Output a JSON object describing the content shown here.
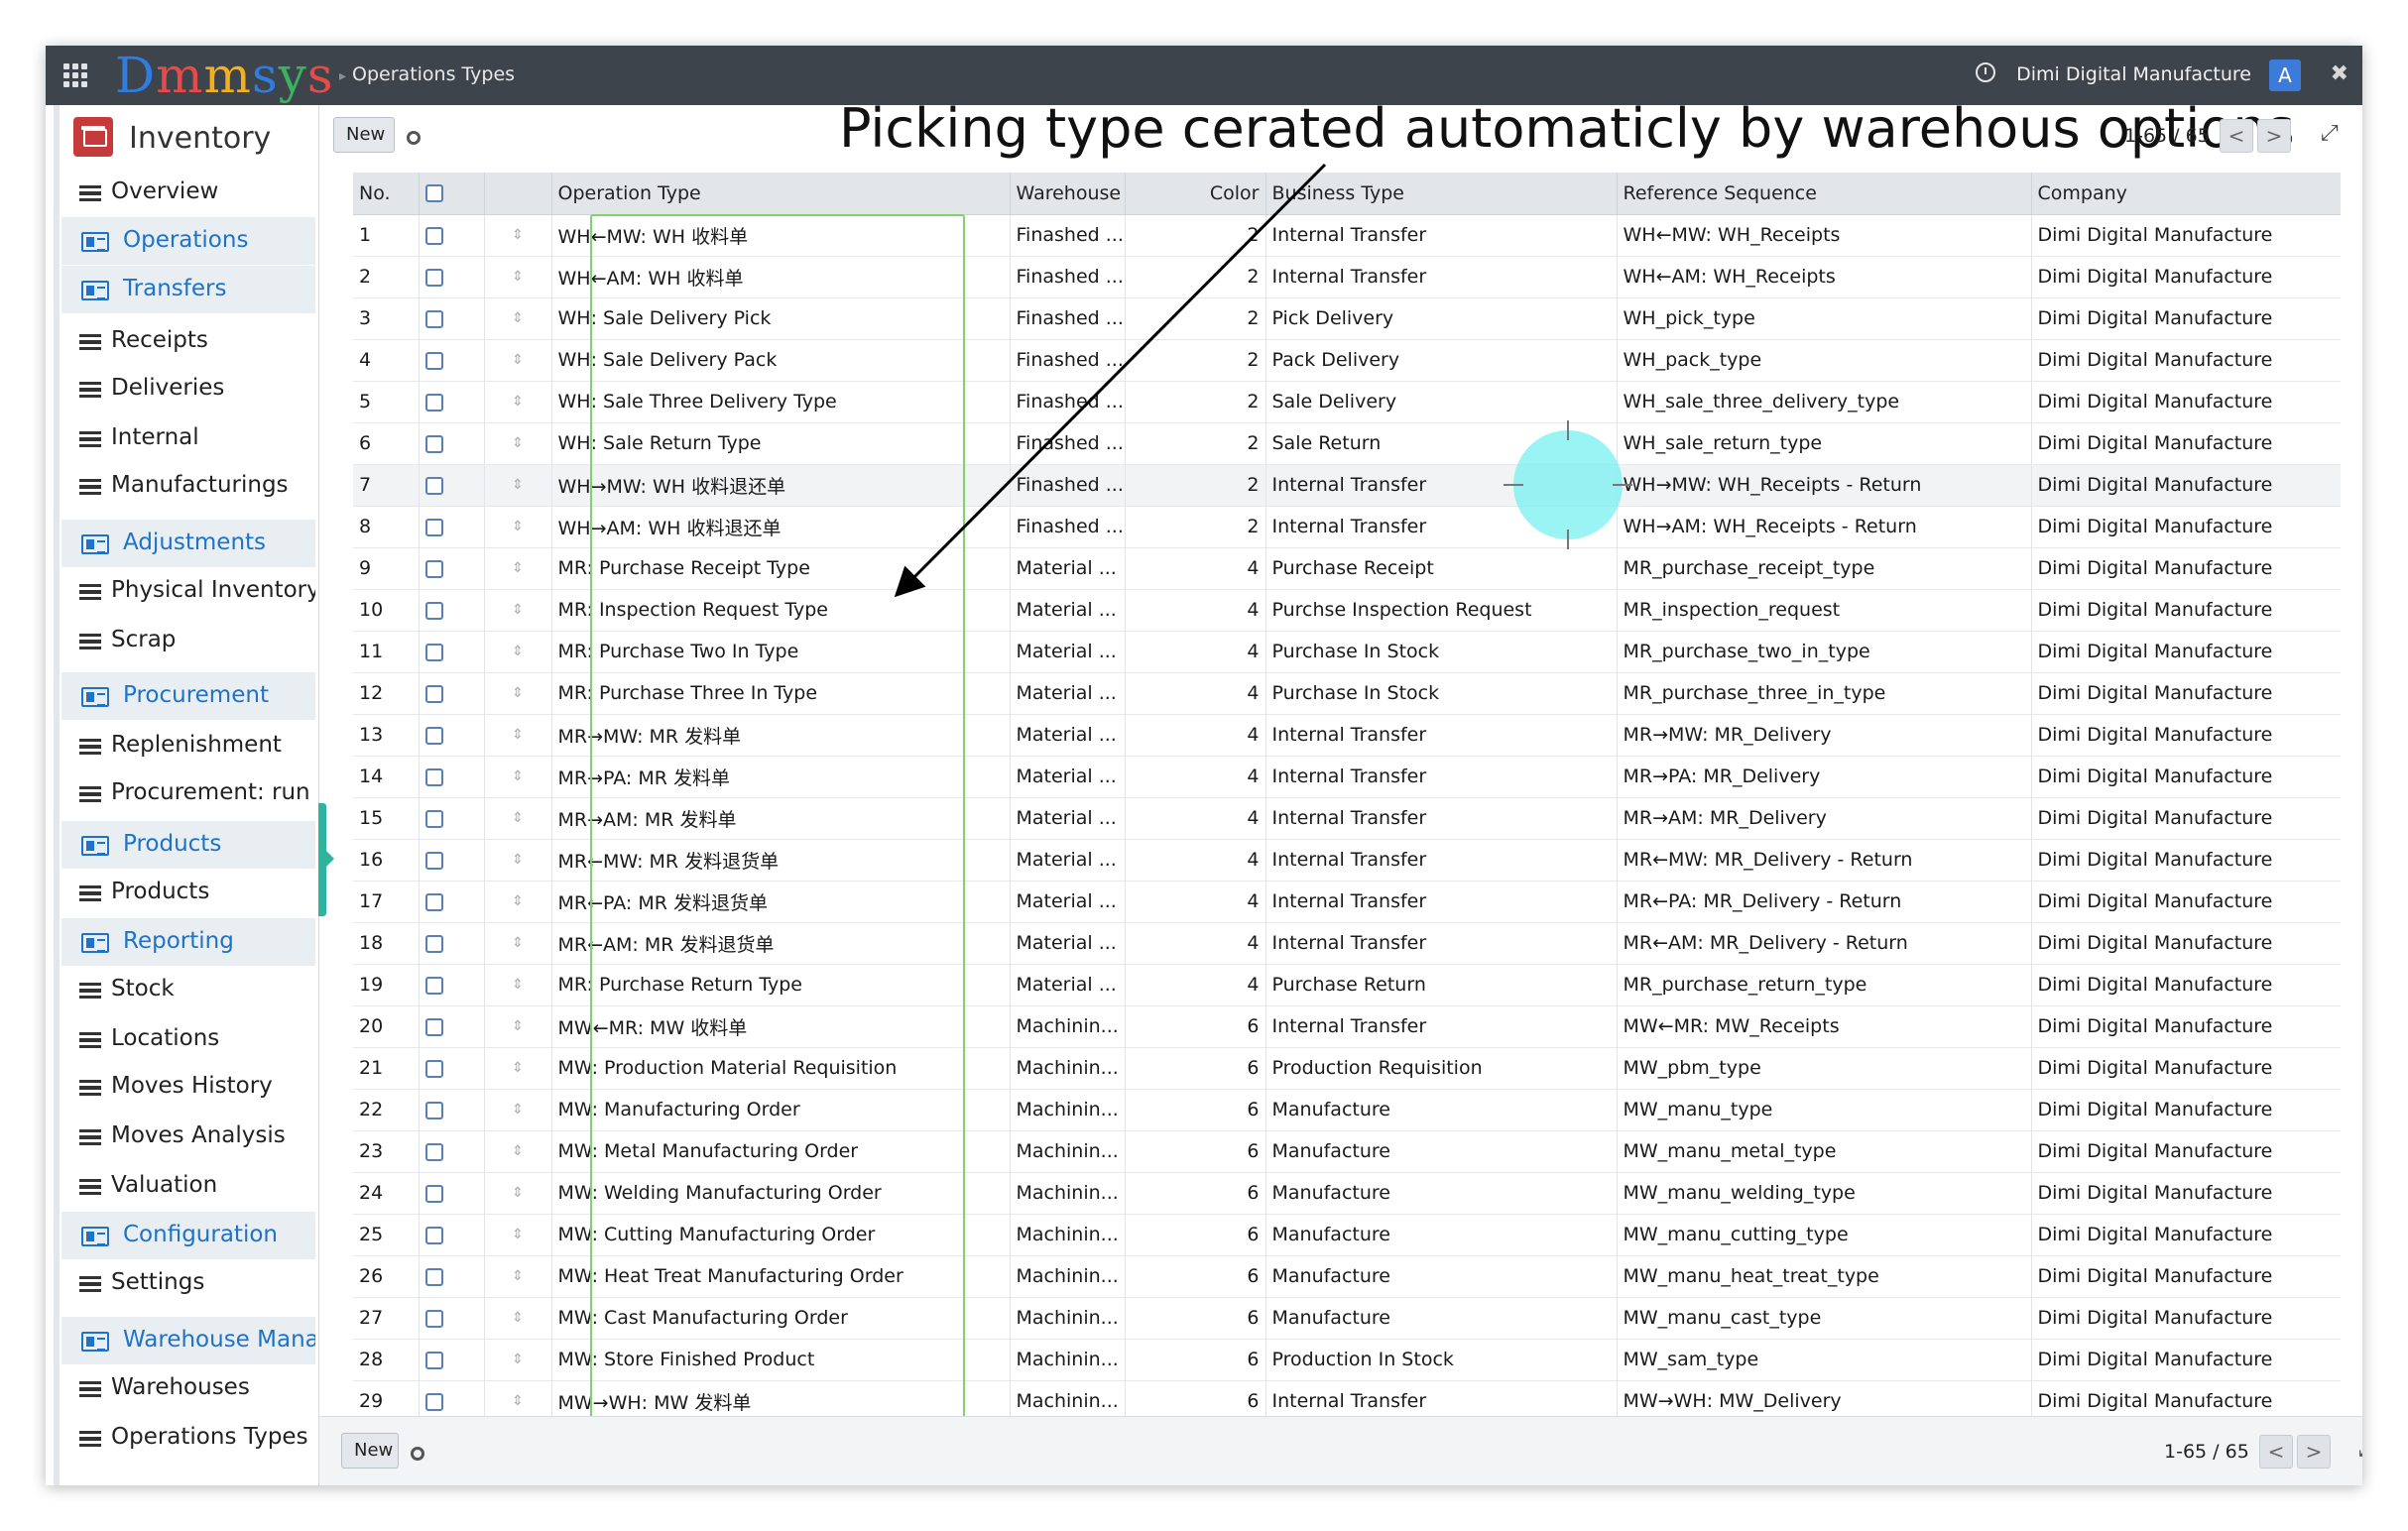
{
  "topbar": {
    "logo": [
      "D",
      "m",
      "m",
      "s",
      "y",
      "s"
    ],
    "breadcrumb": "Operations Types",
    "company": "Dimi Digital Manufacture",
    "avatar": "A"
  },
  "sidebar": {
    "app_name": "Inventory",
    "items": [
      {
        "label": "Overview",
        "group": false
      },
      {
        "label": "Operations",
        "group": true
      },
      {
        "label": "Transfers",
        "group": true
      },
      {
        "label": "Receipts",
        "group": false
      },
      {
        "label": "Deliveries",
        "group": false
      },
      {
        "label": "Internal",
        "group": false
      },
      {
        "label": "Manufacturings",
        "group": false
      },
      {
        "label": "Adjustments",
        "group": true
      },
      {
        "label": "Physical Inventory",
        "group": false
      },
      {
        "label": "Scrap",
        "group": false
      },
      {
        "label": "Procurement",
        "group": true
      },
      {
        "label": "Replenishment",
        "group": false
      },
      {
        "label": "Procurement: run",
        "group": false
      },
      {
        "label": "Products",
        "group": true
      },
      {
        "label": "Products",
        "group": false
      },
      {
        "label": "Reporting",
        "group": true
      },
      {
        "label": "Stock",
        "group": false
      },
      {
        "label": "Locations",
        "group": false
      },
      {
        "label": "Moves History",
        "group": false
      },
      {
        "label": "Moves Analysis",
        "group": false
      },
      {
        "label": "Valuation",
        "group": false
      },
      {
        "label": "Configuration",
        "group": true
      },
      {
        "label": "Settings",
        "group": false
      },
      {
        "label": "Warehouse Manag",
        "group": true
      },
      {
        "label": "Warehouses",
        "group": false
      },
      {
        "label": "Operations Types",
        "group": false
      }
    ]
  },
  "control": {
    "new_label": "New",
    "annotation": "Picking type cerated automaticly by warehous options",
    "pager": "1-65 / 65",
    "prev": "<",
    "next": ">"
  },
  "footer": {
    "new_label": "New",
    "pager": "1-65 / 65"
  },
  "table": {
    "columns": [
      "No.",
      "",
      "",
      "Operation Type",
      "Warehouse",
      "Color",
      "Business Type",
      "Reference Sequence",
      "Company"
    ],
    "rows": [
      [
        "1",
        "WH←MW: WH 收料单",
        "Finashed ...",
        "2",
        "Internal Transfer",
        "WH←MW: WH_Receipts",
        "Dimi Digital Manufacture"
      ],
      [
        "2",
        "WH←AM: WH 收料单",
        "Finashed ...",
        "2",
        "Internal Transfer",
        "WH←AM: WH_Receipts",
        "Dimi Digital Manufacture"
      ],
      [
        "3",
        "WH: Sale Delivery Pick",
        "Finashed ...",
        "2",
        "Pick Delivery",
        "WH_pick_type",
        "Dimi Digital Manufacture"
      ],
      [
        "4",
        "WH: Sale Delivery Pack",
        "Finashed ...",
        "2",
        "Pack Delivery",
        "WH_pack_type",
        "Dimi Digital Manufacture"
      ],
      [
        "5",
        "WH: Sale Three Delivery Type",
        "Finashed ...",
        "2",
        "Sale Delivery",
        "WH_sale_three_delivery_type",
        "Dimi Digital Manufacture"
      ],
      [
        "6",
        "WH: Sale Return Type",
        "Finashed ...",
        "2",
        "Sale Return",
        "WH_sale_return_type",
        "Dimi Digital Manufacture"
      ],
      [
        "7",
        "WH→MW: WH 收料退还单",
        "Finashed ...",
        "2",
        "Internal Transfer",
        "WH→MW: WH_Receipts - Return",
        "Dimi Digital Manufacture"
      ],
      [
        "8",
        "WH→AM: WH 收料退还单",
        "Finashed ...",
        "2",
        "Internal Transfer",
        "WH→AM: WH_Receipts - Return",
        "Dimi Digital Manufacture"
      ],
      [
        "9",
        "MR: Purchase Receipt Type",
        "Material ...",
        "4",
        "Purchase Receipt",
        "MR_purchase_receipt_type",
        "Dimi Digital Manufacture"
      ],
      [
        "10",
        "MR: Inspection Request Type",
        "Material ...",
        "4",
        "Purchse Inspection Request",
        "MR_inspection_request",
        "Dimi Digital Manufacture"
      ],
      [
        "11",
        "MR: Purchase Two In Type",
        "Material ...",
        "4",
        "Purchase In Stock",
        "MR_purchase_two_in_type",
        "Dimi Digital Manufacture"
      ],
      [
        "12",
        "MR: Purchase Three In Type",
        "Material ...",
        "4",
        "Purchase In Stock",
        "MR_purchase_three_in_type",
        "Dimi Digital Manufacture"
      ],
      [
        "13",
        "MR→MW: MR 发料单",
        "Material ...",
        "4",
        "Internal Transfer",
        "MR→MW: MR_Delivery",
        "Dimi Digital Manufacture"
      ],
      [
        "14",
        "MR→PA: MR 发料单",
        "Material ...",
        "4",
        "Internal Transfer",
        "MR→PA: MR_Delivery",
        "Dimi Digital Manufacture"
      ],
      [
        "15",
        "MR→AM: MR 发料单",
        "Material ...",
        "4",
        "Internal Transfer",
        "MR→AM: MR_Delivery",
        "Dimi Digital Manufacture"
      ],
      [
        "16",
        "MR←MW: MR 发料退货单",
        "Material ...",
        "4",
        "Internal Transfer",
        "MR←MW: MR_Delivery - Return",
        "Dimi Digital Manufacture"
      ],
      [
        "17",
        "MR←PA: MR 发料退货单",
        "Material ...",
        "4",
        "Internal Transfer",
        "MR←PA: MR_Delivery - Return",
        "Dimi Digital Manufacture"
      ],
      [
        "18",
        "MR←AM: MR 发料退货单",
        "Material ...",
        "4",
        "Internal Transfer",
        "MR←AM: MR_Delivery - Return",
        "Dimi Digital Manufacture"
      ],
      [
        "19",
        "MR: Purchase Return Type",
        "Material ...",
        "4",
        "Purchase Return",
        "MR_purchase_return_type",
        "Dimi Digital Manufacture"
      ],
      [
        "20",
        "MW←MR: MW 收料单",
        "Machinin...",
        "6",
        "Internal Transfer",
        "MW←MR: MW_Receipts",
        "Dimi Digital Manufacture"
      ],
      [
        "21",
        "MW: Production Material Requisition",
        "Machinin...",
        "6",
        "Production Requisition",
        "MW_pbm_type",
        "Dimi Digital Manufacture"
      ],
      [
        "22",
        "MW: Manufacturing Order",
        "Machinin...",
        "6",
        "Manufacture",
        "MW_manu_type",
        "Dimi Digital Manufacture"
      ],
      [
        "23",
        "MW: Metal Manufacturing Order",
        "Machinin...",
        "6",
        "Manufacture",
        "MW_manu_metal_type",
        "Dimi Digital Manufacture"
      ],
      [
        "24",
        "MW: Welding Manufacturing Order",
        "Machinin...",
        "6",
        "Manufacture",
        "MW_manu_welding_type",
        "Dimi Digital Manufacture"
      ],
      [
        "25",
        "MW: Cutting Manufacturing Order",
        "Machinin...",
        "6",
        "Manufacture",
        "MW_manu_cutting_type",
        "Dimi Digital Manufacture"
      ],
      [
        "26",
        "MW: Heat Treat Manufacturing Order",
        "Machinin...",
        "6",
        "Manufacture",
        "MW_manu_heat_treat_type",
        "Dimi Digital Manufacture"
      ],
      [
        "27",
        "MW: Cast Manufacturing Order",
        "Machinin...",
        "6",
        "Manufacture",
        "MW_manu_cast_type",
        "Dimi Digital Manufacture"
      ],
      [
        "28",
        "MW: Store Finished Product",
        "Machinin...",
        "6",
        "Production In Stock",
        "MW_sam_type",
        "Dimi Digital Manufacture"
      ],
      [
        "29",
        "MW→WH: MW 发料单",
        "Machinin...",
        "6",
        "Internal Transfer",
        "MW→WH: MW_Delivery",
        "Dimi Digital Manufacture"
      ]
    ],
    "highlight_row": 7
  },
  "colors": {
    "topbar": "#3e444b",
    "accent": "#1e72c7",
    "annotation_box": "#7fd36a",
    "cursor": "#78f0f0"
  }
}
